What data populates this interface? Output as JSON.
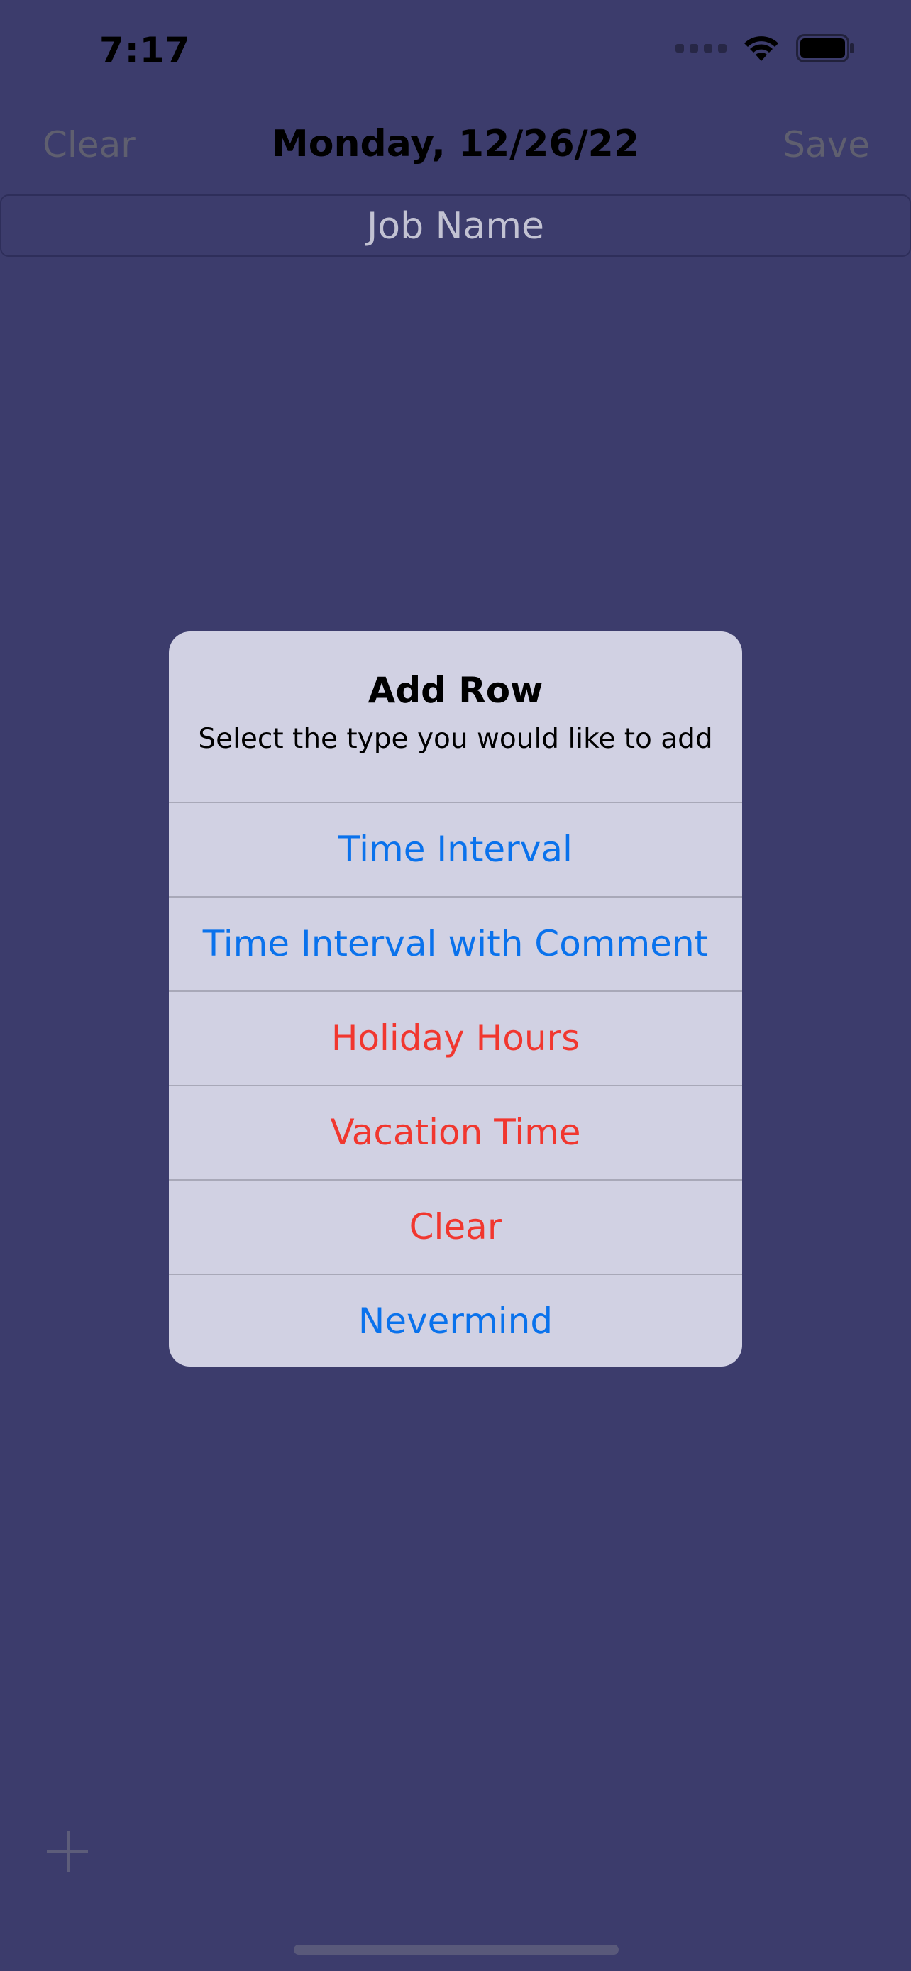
{
  "status_bar": {
    "time": "7:17",
    "icons": [
      "signal-icon",
      "wifi-icon",
      "battery-icon"
    ]
  },
  "nav": {
    "left_label": "Clear",
    "title": "Monday, 12/26/22",
    "right_label": "Save"
  },
  "job_name": {
    "placeholder": "Job Name"
  },
  "alert": {
    "title": "Add Row",
    "message": "Select the type you would like to add",
    "buttons": [
      {
        "label": "Time Interval",
        "style": "default"
      },
      {
        "label": "Time Interval with Comment",
        "style": "default"
      },
      {
        "label": "Holiday Hours",
        "style": "destructive"
      },
      {
        "label": "Vacation Time",
        "style": "destructive"
      },
      {
        "label": "Clear",
        "style": "destructive"
      },
      {
        "label": "Nevermind",
        "style": "default"
      }
    ]
  },
  "toolbar": {
    "add_icon": "plus-icon"
  },
  "colors": {
    "background": "#3c3c6c",
    "alert_background": "#d1d1e3",
    "default_action": "#0a72ec",
    "destructive_action": "#f1372f"
  }
}
